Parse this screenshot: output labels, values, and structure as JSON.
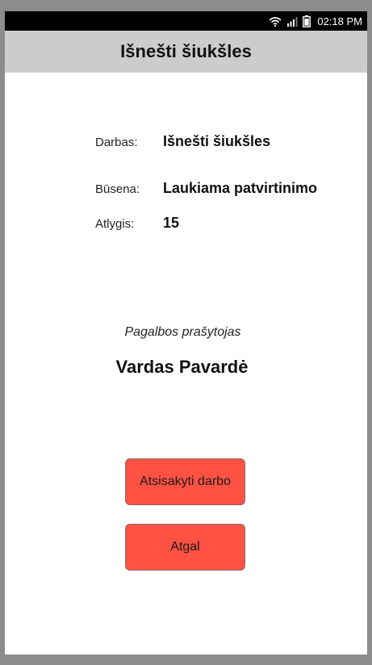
{
  "status_bar": {
    "time": "02:18 PM",
    "icons": [
      "wifi-icon",
      "signal-icon",
      "battery-icon"
    ]
  },
  "header": {
    "title": "Išnešti šiukšles"
  },
  "details": {
    "job_label": "Darbas:",
    "job_value": "Išnešti šiukšles",
    "status_label": "Būsena:",
    "status_value": "Laukiama patvirtinimo",
    "reward_label": "Atlygis:",
    "reward_value": "15"
  },
  "requester": {
    "caption": "Pagalbos prašytojas",
    "name": "Vardas Pavardė"
  },
  "actions": {
    "cancel_job_label": "Atsisakyti darbo",
    "back_label": "Atgal"
  },
  "colors": {
    "button_bg": "#ff5244",
    "title_bar_bg": "#cccccc",
    "status_bar_bg": "#000000"
  }
}
